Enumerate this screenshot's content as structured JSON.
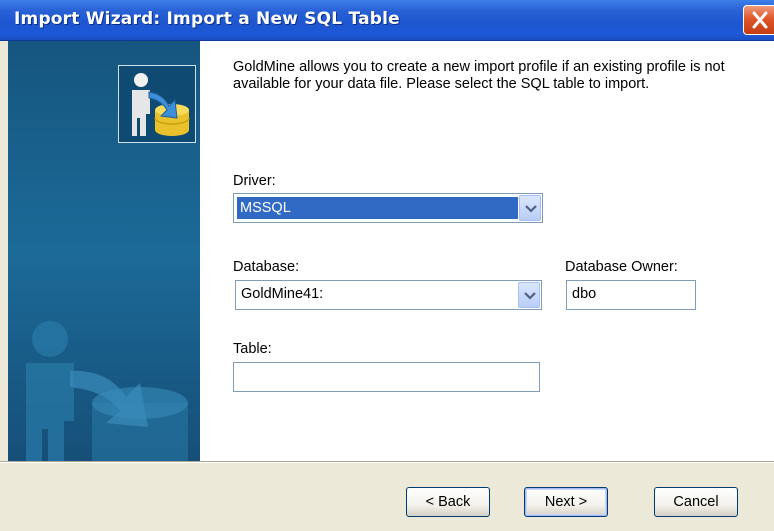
{
  "window": {
    "title": "Import Wizard:  Import a New SQL Table"
  },
  "banner": {
    "icon": "import-wizard-icon",
    "watermark": "import-wizard-watermark-icon"
  },
  "main": {
    "description": "GoldMine allows you to create a new import profile if an existing profile is not available for your data file.  Please select the SQL table to import.",
    "driver": {
      "label": "Driver:",
      "value": "MSSQL"
    },
    "database": {
      "label": "Database:",
      "value": "GoldMine41:"
    },
    "database_owner": {
      "label": "Database Owner:",
      "value": "dbo"
    },
    "table": {
      "label": "Table:",
      "value": ""
    }
  },
  "buttons": {
    "back": "< Back",
    "next": "Next >",
    "cancel": "Cancel"
  },
  "colors": {
    "title_bar": "#1d56d0",
    "banner": "#1c6a98",
    "selection": "#316ac5",
    "close_button": "#e0562a"
  }
}
